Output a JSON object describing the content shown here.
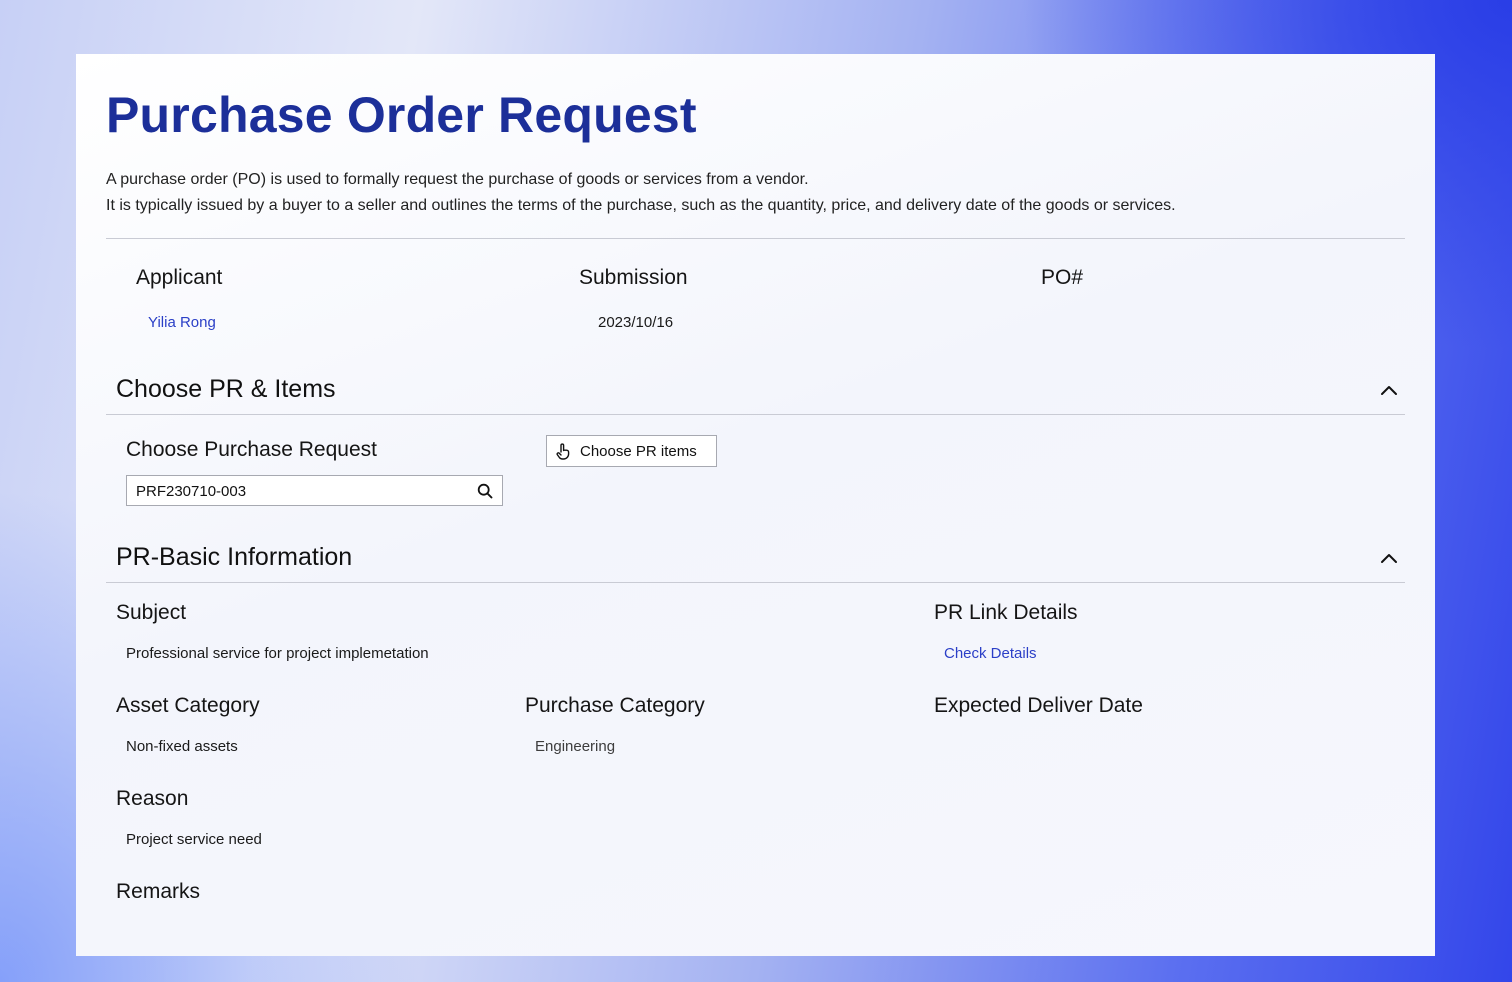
{
  "header": {
    "title": "Purchase Order Request",
    "description_line1": "A purchase order (PO) is used to formally request the purchase of goods or services from a vendor.",
    "description_line2": "It is typically issued by a buyer to a seller and outlines the terms of the purchase, such as the quantity, price, and delivery date of the goods or services."
  },
  "summary": {
    "applicant_label": "Applicant",
    "applicant_value": "Yilia Rong",
    "submission_label": "Submission",
    "submission_value": "2023/10/16",
    "po_label": "PO#",
    "po_value": ""
  },
  "choose_section": {
    "title": "Choose PR & Items",
    "collapse_icon": "chevron-up-icon",
    "request_label": "Choose Purchase Request",
    "request_value": "PRF230710-003",
    "search_icon": "search-icon",
    "items_button_label": "Choose PR items",
    "items_button_icon": "hand-pointer-icon"
  },
  "basic_info": {
    "title": "PR-Basic Information",
    "collapse_icon": "chevron-up-icon",
    "subject_label": "Subject",
    "subject_value": "Professional service for project implemetation",
    "link_label": "PR Link Details",
    "link_value": "Check Details",
    "asset_label": "Asset Category",
    "asset_value": "Non-fixed assets",
    "purchase_category_label": "Purchase Category",
    "purchase_category_value": "Engineering",
    "delivery_label": "Expected Deliver Date",
    "delivery_value": "",
    "reason_label": "Reason",
    "reason_value": "Project service need",
    "remarks_label": "Remarks",
    "remarks_value": ""
  },
  "colors": {
    "title": "#1c2f99",
    "link": "#2b3fc7",
    "divider": "#c9cbd4",
    "background_accent": "#3346ea"
  }
}
